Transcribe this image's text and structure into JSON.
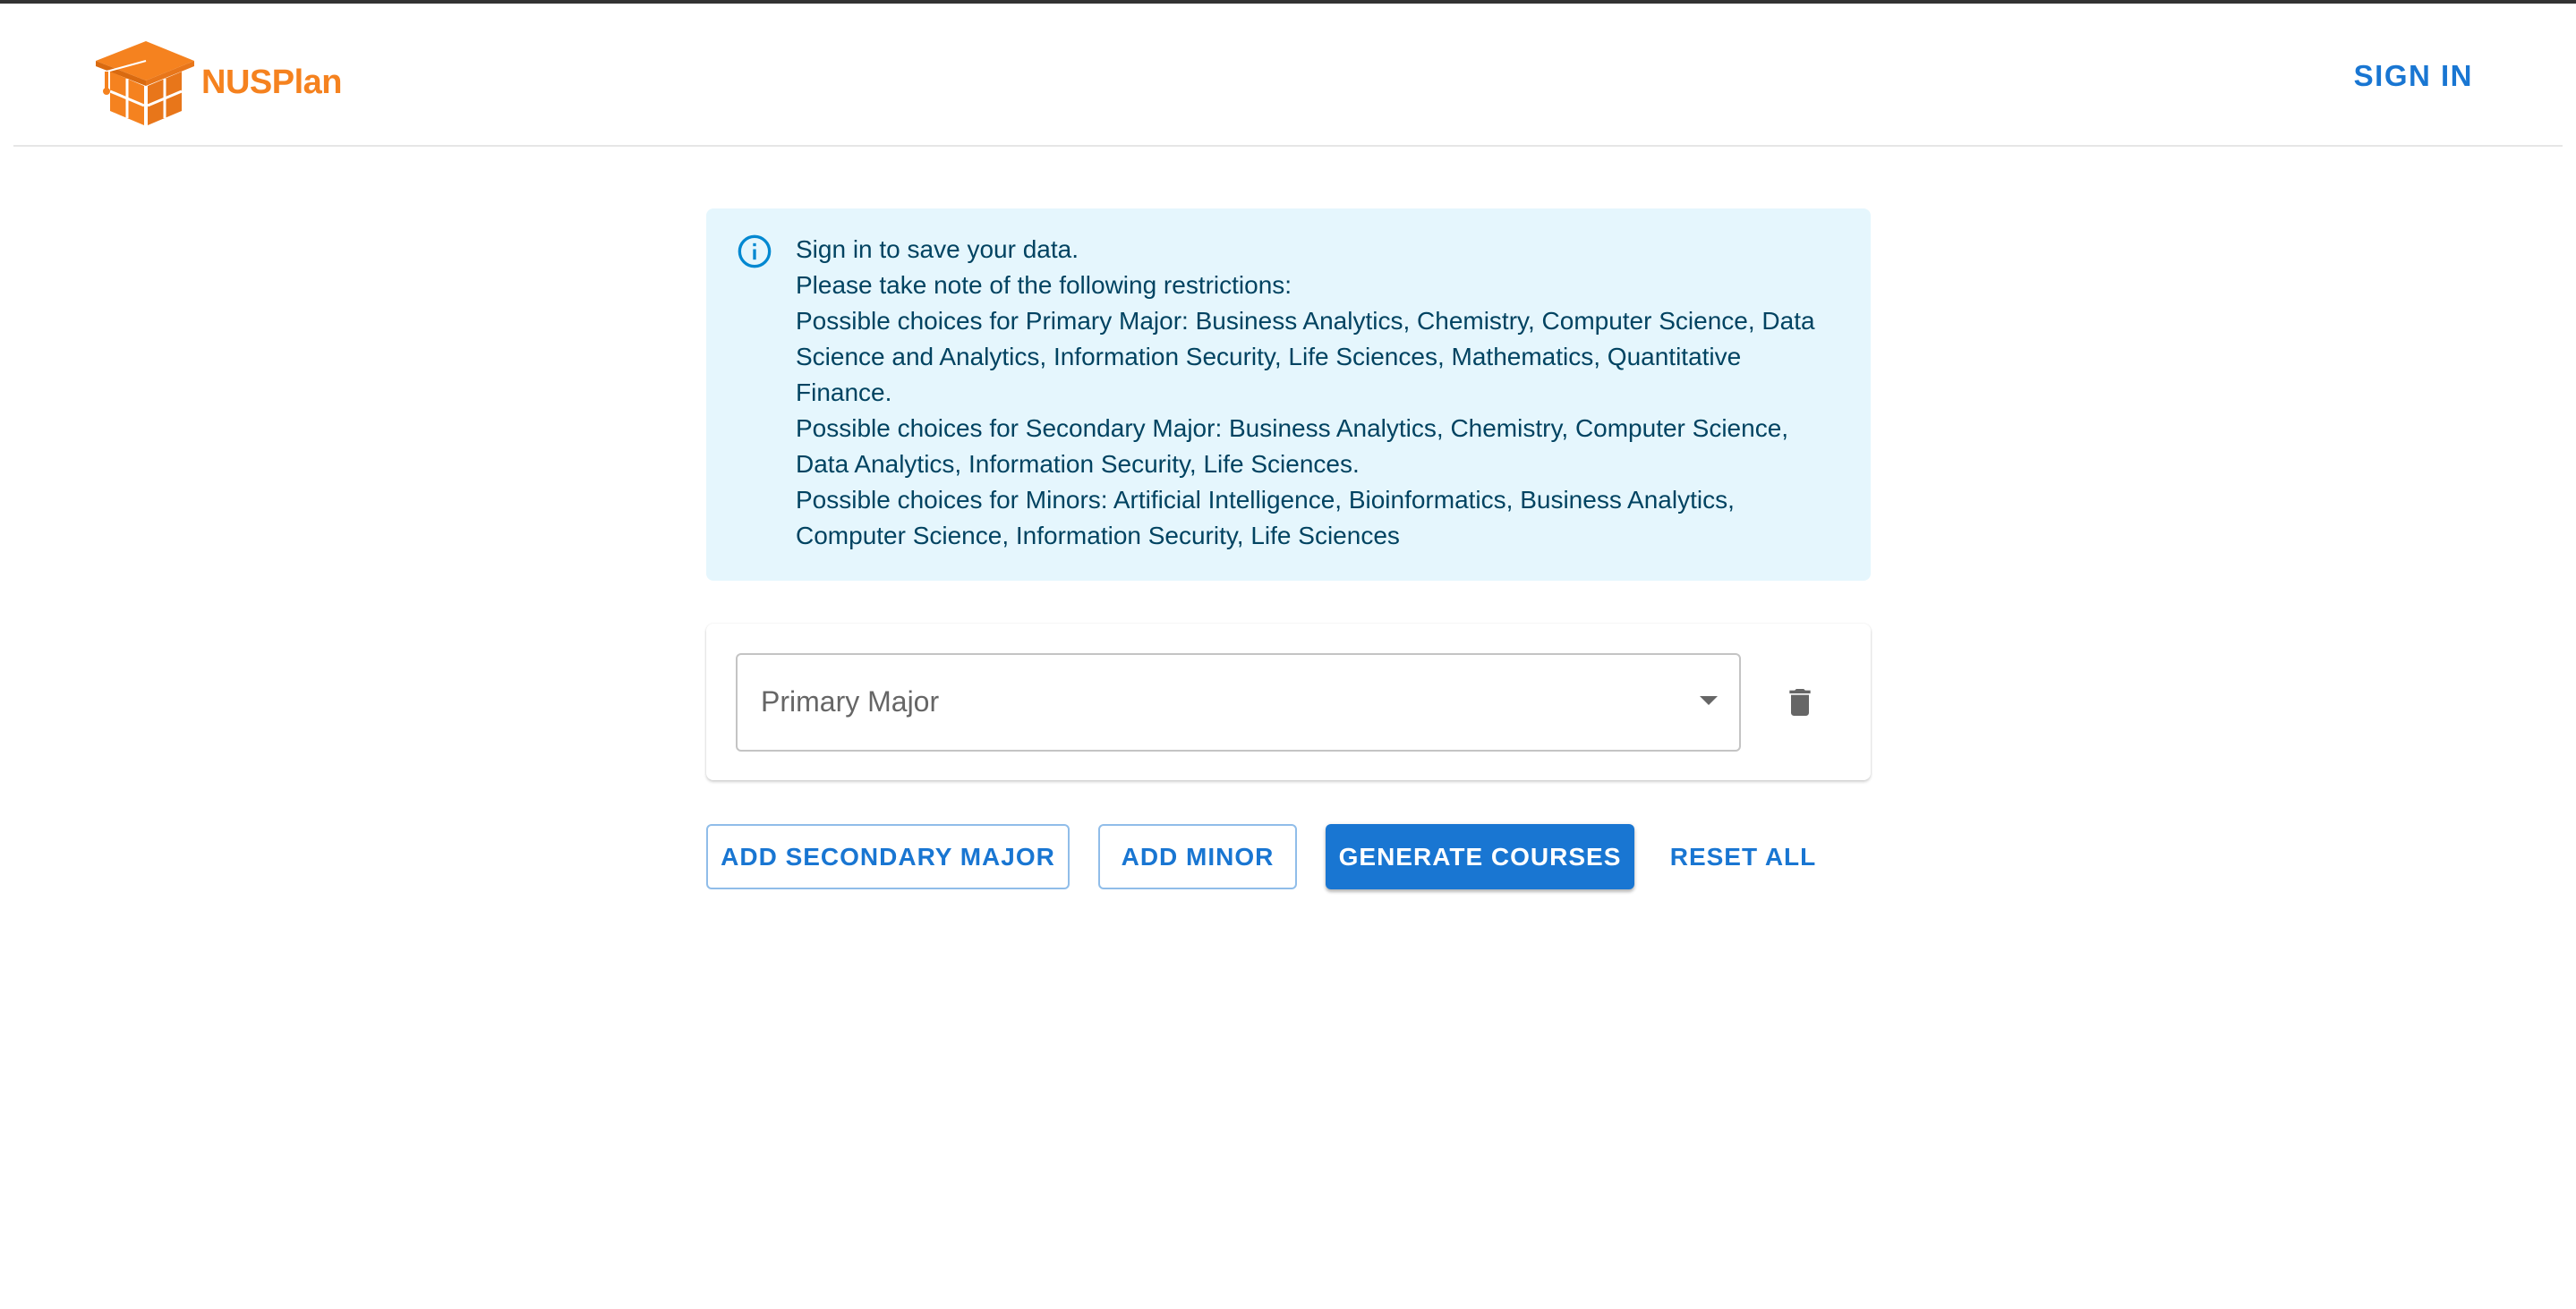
{
  "header": {
    "logo_text": "NUSPlan",
    "sign_in_label": "SIGN IN"
  },
  "alert": {
    "lines": [
      "Sign in to save your data.",
      "Please take note of the following restrictions:",
      "Possible choices for Primary Major: Business Analytics, Chemistry, Computer Science, Data Science and Analytics, Information Security, Life Sciences, Mathematics, Quantitative Finance.",
      "Possible choices for Secondary Major: Business Analytics, Chemistry, Computer Science, Data Analytics, Information Security, Life Sciences.",
      "Possible choices for Minors: Artificial Intelligence, Bioinformatics, Business Analytics, Computer Science, Information Security, Life Sciences"
    ]
  },
  "selection_card": {
    "primary_major_label": "Primary Major"
  },
  "actions": {
    "add_secondary_major": "ADD SECONDARY MAJOR",
    "add_minor": "ADD MINOR",
    "generate_courses": "GENERATE COURSES",
    "reset_all": "RESET ALL"
  },
  "colors": {
    "brand_orange": "#f5821f",
    "primary_blue": "#1976d2",
    "alert_background": "#e5f6fd",
    "alert_text": "#014361"
  },
  "icons": {
    "logo": "graduation-cap-box-icon",
    "info": "info-outline-icon",
    "dropdown": "arrow-drop-down-icon",
    "delete": "trash-icon"
  }
}
